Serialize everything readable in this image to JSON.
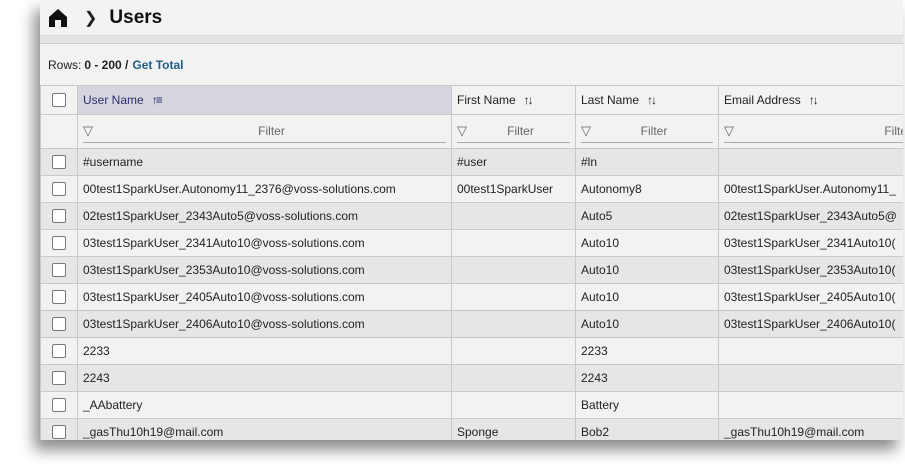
{
  "header": {
    "title": "Users",
    "home_icon": "home-icon",
    "separator_icon": "chevron-right-icon"
  },
  "rows_info": {
    "label": "Rows:",
    "range": "0 - 200 /",
    "get_total": "Get Total"
  },
  "columns": [
    {
      "label": "User Name",
      "sort": "ascending",
      "filter_placeholder": "Filter"
    },
    {
      "label": "First Name",
      "sort": "none",
      "filter_placeholder": "Filter"
    },
    {
      "label": "Last Name",
      "sort": "none",
      "filter_placeholder": "Filter"
    },
    {
      "label": "Email Address",
      "sort": "none",
      "filter_placeholder": "Filter"
    }
  ],
  "rows": [
    [
      "#username",
      "#user",
      "#ln",
      ""
    ],
    [
      "00test1SparkUser.Autonomy11_2376@voss-solutions.com",
      "00test1SparkUser",
      "Autonomy8",
      "00test1SparkUser.Autonomy11_"
    ],
    [
      "02test1SparkUser_2343Auto5@voss-solutions.com",
      "",
      "Auto5",
      "02test1SparkUser_2343Auto5@"
    ],
    [
      "03test1SparkUser_2341Auto10@voss-solutions.com",
      "",
      "Auto10",
      "03test1SparkUser_2341Auto10("
    ],
    [
      "03test1SparkUser_2353Auto10@voss-solutions.com",
      "",
      "Auto10",
      "03test1SparkUser_2353Auto10("
    ],
    [
      "03test1SparkUser_2405Auto10@voss-solutions.com",
      "",
      "Auto10",
      "03test1SparkUser_2405Auto10("
    ],
    [
      "03test1SparkUser_2406Auto10@voss-solutions.com",
      "",
      "Auto10",
      "03test1SparkUser_2406Auto10("
    ],
    [
      "2233",
      "",
      "2233",
      ""
    ],
    [
      "2243",
      "",
      "2243",
      ""
    ],
    [
      "_AAbattery",
      "",
      "Battery",
      ""
    ],
    [
      "_gasThu10h19@mail.com",
      "Sponge",
      "Bob2",
      "_gasThu10h19@mail.com"
    ]
  ]
}
